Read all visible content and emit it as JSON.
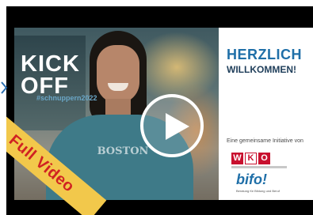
{
  "video": {
    "title_line1": "KICK",
    "title_line2": "OFF",
    "hashtag": "#schnuppern2022",
    "hoodie_text": "BOSTON",
    "welcome_line1": "HERZLICH",
    "welcome_line2": "WILLKOMMEN!",
    "initiative": "Eine gemeinsame Initiative von",
    "wko_letters": [
      "W",
      "K",
      "O"
    ],
    "bifo": "bifo!",
    "bifo_sub": "Beratung für Bildung und Beruf",
    "ribbon": "Full Video"
  },
  "colors": {
    "ribbon": "#f2c84b",
    "ribbon_text": "#d02222",
    "brand_blue": "#1f6fa8",
    "wko_red": "#c8102e"
  },
  "icons": [
    "play-icon",
    "chevron-left-icon"
  ]
}
